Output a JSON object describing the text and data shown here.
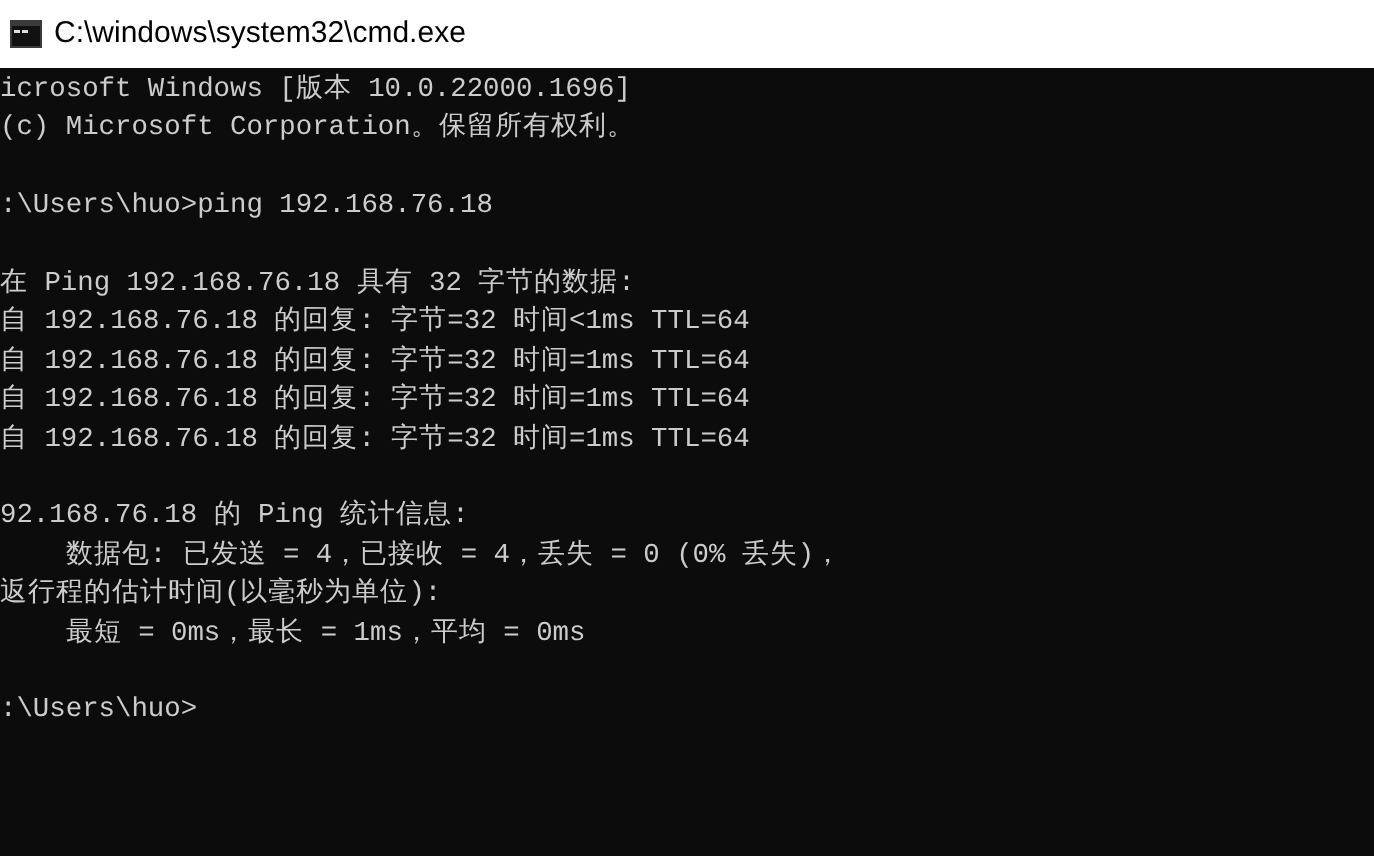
{
  "window": {
    "title": "C:\\windows\\system32\\cmd.exe"
  },
  "console": {
    "blocks": [
      [
        "icrosoft Windows [版本 10.0.22000.1696]",
        "(c) Microsoft Corporation。保留所有权利。"
      ],
      [
        ":\\Users\\huo>ping 192.168.76.18"
      ],
      [
        "在 Ping 192.168.76.18 具有 32 字节的数据:",
        "自 192.168.76.18 的回复: 字节=32 时间<1ms TTL=64",
        "自 192.168.76.18 的回复: 字节=32 时间=1ms TTL=64",
        "自 192.168.76.18 的回复: 字节=32 时间=1ms TTL=64",
        "自 192.168.76.18 的回复: 字节=32 时间=1ms TTL=64"
      ],
      [
        "92.168.76.18 的 Ping 统计信息:",
        "    数据包: 已发送 = 4，已接收 = 4，丢失 = 0 (0% 丢失)，",
        "返行程的估计时间(以毫秒为单位):",
        "    最短 = 0ms，最长 = 1ms，平均 = 0ms"
      ],
      [
        ":\\Users\\huo>"
      ]
    ]
  }
}
